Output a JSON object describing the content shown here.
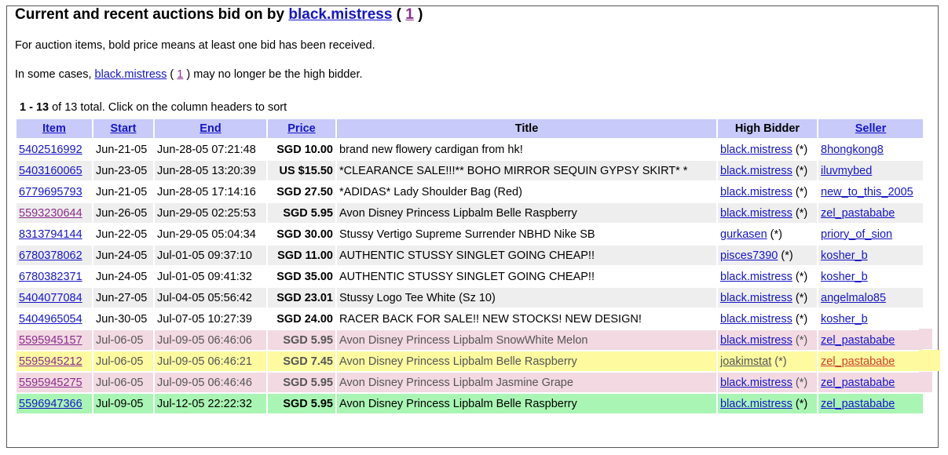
{
  "heading": {
    "prefix": "Current and recent auctions bid on by ",
    "user": "black.mistress",
    "paren_open": " ( ",
    "feedback": "1",
    "paren_close": " )"
  },
  "notes": {
    "bold_price": "For auction items, bold price means at least one bid has been received.",
    "high_bidder_prefix": "In some cases, ",
    "high_bidder_user": "black.mistress",
    "high_bidder_paren_open": " ( ",
    "high_bidder_feedback": "1",
    "high_bidder_suffix": " ) may no longer be the high bidder."
  },
  "summary": {
    "range": "1 - 13",
    "text": " of 13 total. Click on the column headers to sort"
  },
  "columns": {
    "item": "Item",
    "start": "Start",
    "end": "End",
    "price": "Price",
    "title": "Title",
    "high_bidder": "High Bidder",
    "seller": "Seller"
  },
  "rows": [
    {
      "item": "5402516992",
      "start": "Jun-21-05",
      "end": "Jun-28-05 07:21:48",
      "price": "SGD 10.00",
      "title": "brand new flowery cardigan from hk!",
      "bidder": "black.mistress",
      "bidder_suffix": " (*)",
      "seller": "8hongkong8"
    },
    {
      "item": "5403160065",
      "start": "Jun-23-05",
      "end": "Jun-28-05 13:20:39",
      "price": "US $15.50",
      "title": "*CLEARANCE SALE!!!** BOHO MIRROR SEQUIN GYPSY SKIRT* *",
      "bidder": "black.mistress",
      "bidder_suffix": " (*)",
      "seller": "iluvmybed"
    },
    {
      "item": "6779695793",
      "start": "Jun-21-05",
      "end": "Jun-28-05 17:14:16",
      "price": "SGD 27.50",
      "title": "*ADIDAS* Lady Shoulder Bag (Red)",
      "bidder": "black.mistress",
      "bidder_suffix": " (*)",
      "seller": "new_to_this_2005"
    },
    {
      "item": "5593230644",
      "start": "Jun-26-05",
      "end": "Jun-29-05 02:25:53",
      "price": "SGD 5.95",
      "title": "Avon Disney Princess Lipbalm Belle Raspberry",
      "bidder": "black.mistress",
      "bidder_suffix": " (*)",
      "seller": "zel_pastababe"
    },
    {
      "item": "8313794144",
      "start": "Jun-22-05",
      "end": "Jun-29-05 05:04:34",
      "price": "SGD 30.00",
      "title": "Stussy Vertigo Supreme Surrender NBHD Nike SB",
      "bidder": "gurkasen",
      "bidder_suffix": " (*)",
      "seller": "priory_of_sion"
    },
    {
      "item": "6780378062",
      "start": "Jun-24-05",
      "end": "Jul-01-05 09:37:10",
      "price": "SGD 11.00",
      "title": "AUTHENTIC STUSSY SINGLET GOING CHEAP!!",
      "bidder": "pisces7390",
      "bidder_suffix": " (*)",
      "seller": "kosher_b"
    },
    {
      "item": "6780382371",
      "start": "Jun-24-05",
      "end": "Jul-01-05 09:41:32",
      "price": "SGD 35.00",
      "title": "AUTHENTIC STUSSY SINGLET GOING CHEAP!!",
      "bidder": "black.mistress",
      "bidder_suffix": " (*)",
      "seller": "kosher_b"
    },
    {
      "item": "5404077084",
      "start": "Jun-27-05",
      "end": "Jul-04-05 05:56:42",
      "price": "SGD 23.01",
      "title": "Stussy Logo Tee White (Sz 10)",
      "bidder": "black.mistress",
      "bidder_suffix": " (*)",
      "seller": "angelmalo85"
    },
    {
      "item": "5404965054",
      "start": "Jun-30-05",
      "end": "Jul-07-05 10:27:39",
      "price": "SGD 24.00",
      "title": "RACER BACK FOR SALE!! NEW STOCKS! NEW DESIGN!",
      "bidder": "black.mistress",
      "bidder_suffix": " (*)",
      "seller": "kosher_b"
    },
    {
      "item": "5595945157",
      "start": "Jul-06-05",
      "end": "Jul-09-05 06:46:06",
      "price": "SGD 5.95",
      "title": "Avon Disney Princess Lipbalm SnowWhite Melon",
      "bidder": "black.mistress",
      "bidder_suffix": " (*)",
      "seller": "zel_pastababe"
    },
    {
      "item": "5595945212",
      "start": "Jul-06-05",
      "end": "Jul-09-05 06:46:21",
      "price": "SGD 7.45",
      "title": "Avon Disney Princess Lipbalm Belle Raspberry",
      "bidder": "joakimstat",
      "bidder_suffix": " (*)",
      "seller": "zel_pastababe"
    },
    {
      "item": "5595945275",
      "start": "Jul-06-05",
      "end": "Jul-09-05 06:46:46",
      "price": "SGD 5.95",
      "title": "Avon Disney Princess Lipbalm Jasmine Grape",
      "bidder": "black.mistress",
      "bidder_suffix": " (*)",
      "seller": "zel_pastababe"
    },
    {
      "item": "5596947366",
      "start": "Jul-09-05",
      "end": "Jul-12-05 22:22:32",
      "price": "SGD 5.95",
      "title": "Avon Disney Princess Lipbalm Belle Raspberry",
      "bidder": "black.mistress",
      "bidder_suffix": " (*)",
      "seller": "zel_pastababe"
    }
  ],
  "colors": {
    "header_bg": "#c8cafa",
    "link": "#1515c8",
    "visited_link": "#8a2c8a",
    "highlight_pink": "#f2d9e2",
    "highlight_yellow": "#fdfaa0",
    "highlight_green": "#a9f5b4",
    "alt_row": "#eeeeee"
  }
}
